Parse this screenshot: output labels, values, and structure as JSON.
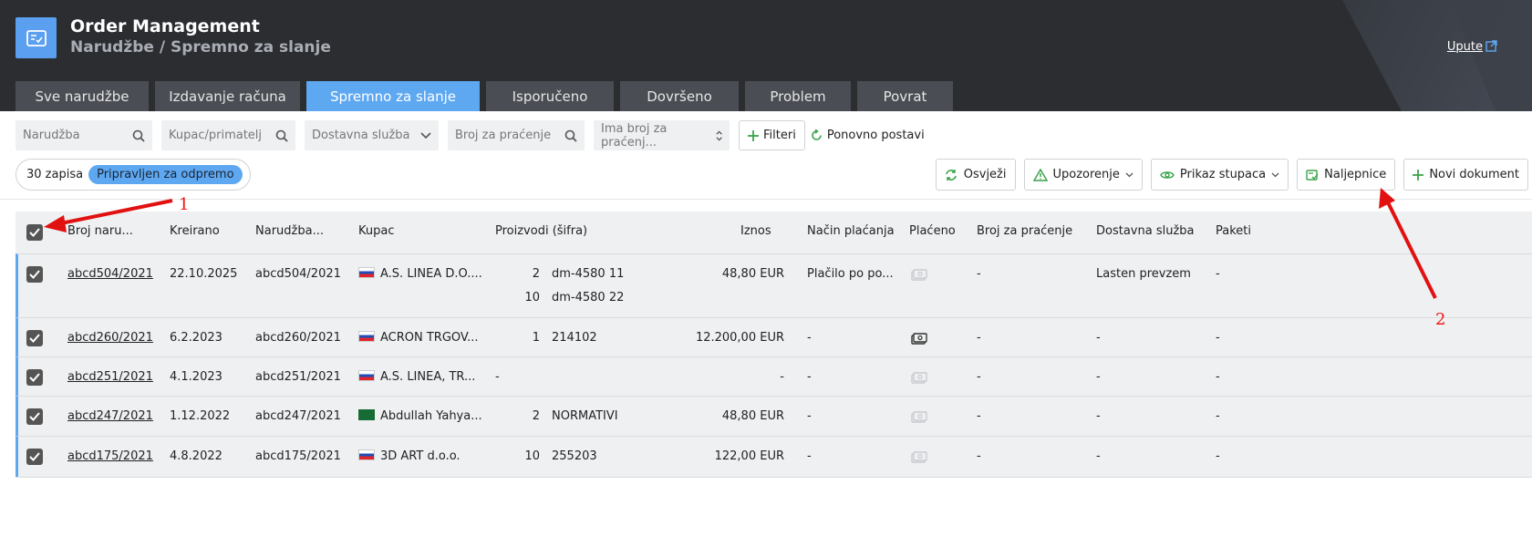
{
  "header": {
    "title": "Order Management",
    "breadcrumb": "Narudžbe / Spremno za slanje",
    "help_link": "Upute"
  },
  "tabs": [
    {
      "label": "Sve narudžbe",
      "active": false
    },
    {
      "label": "Izdavanje računa",
      "active": false
    },
    {
      "label": "Spremno za slanje",
      "active": true
    },
    {
      "label": "Isporučeno",
      "active": false
    },
    {
      "label": "Dovršeno",
      "active": false
    },
    {
      "label": "Problem",
      "active": false
    },
    {
      "label": "Povrat",
      "active": false
    }
  ],
  "filters": {
    "order_placeholder": "Narudžba",
    "customer_placeholder": "Kupac/primatelj",
    "delivery_select": "Dostavna služba",
    "tracking_placeholder": "Broj za praćenje",
    "has_tracking_select": "Ima broj za praćenj...",
    "filters_button": "Filteri",
    "reset_button": "Ponovno postavi"
  },
  "records": {
    "count_text": "30 zapisa",
    "status_pill": "Pripravljen za odpremo"
  },
  "actions": {
    "refresh": "Osvježi",
    "warning": "Upozorenje",
    "columns": "Prikaz stupaca",
    "labels": "Naljepnice",
    "new_document": "Novi dokument"
  },
  "columns": {
    "order_no": "Broj naru...",
    "created": "Kreirano",
    "order": "Narudžba...",
    "customer": "Kupac",
    "products": "Proizvodi (šifra)",
    "amount": "Iznos",
    "payment_method": "Način plaćanja",
    "paid": "Plaćeno",
    "tracking": "Broj za praćenje",
    "delivery": "Dostavna služba",
    "packages": "Paketi"
  },
  "rows": [
    {
      "order_no": "abcd504/2021",
      "created": "22.10.2025",
      "order": "abcd504/2021",
      "flag": "SI",
      "customer": "A.S. LINEA D.O....",
      "products": [
        {
          "qty": "2",
          "code": "dm-4580 11"
        },
        {
          "qty": "10",
          "code": "dm-4580 22"
        }
      ],
      "amount": "48,80 EUR",
      "payment": "Plačilo po po...",
      "paid": false,
      "tracking": "-",
      "delivery": "Lasten prevzem",
      "packages": "-"
    },
    {
      "order_no": "abcd260/2021",
      "created": "6.2.2023",
      "order": "abcd260/2021",
      "flag": "SI",
      "customer": "ACRON TRGOV...",
      "products": [
        {
          "qty": "1",
          "code": "214102"
        }
      ],
      "amount": "12.200,00 EUR",
      "payment": "-",
      "paid": true,
      "tracking": "-",
      "delivery": "-",
      "packages": "-"
    },
    {
      "order_no": "abcd251/2021",
      "created": "4.1.2023",
      "order": "abcd251/2021",
      "flag": "SI",
      "customer": "A.S. LINEA, TR...",
      "products": [
        {
          "qty": "-",
          "code": ""
        }
      ],
      "amount": "-",
      "payment": "-",
      "paid": false,
      "tracking": "-",
      "delivery": "-",
      "packages": "-"
    },
    {
      "order_no": "abcd247/2021",
      "created": "1.12.2022",
      "order": "abcd247/2021",
      "flag": "SA",
      "customer": "Abdullah Yahya...",
      "products": [
        {
          "qty": "2",
          "code": "NORMATIVI"
        }
      ],
      "amount": "48,80 EUR",
      "payment": "-",
      "paid": false,
      "tracking": "-",
      "delivery": "-",
      "packages": "-"
    },
    {
      "order_no": "abcd175/2021",
      "created": "4.8.2022",
      "order": "abcd175/2021",
      "flag": "SI",
      "customer": "3D ART d.o.o.",
      "products": [
        {
          "qty": "10",
          "code": "255203"
        }
      ],
      "amount": "122,00 EUR",
      "payment": "-",
      "paid": false,
      "tracking": "-",
      "delivery": "-",
      "packages": "-"
    }
  ],
  "annotations": {
    "one": "1",
    "two": "2"
  },
  "colors": {
    "accent": "#5ea8f2",
    "header_bg": "#2b2d31",
    "annotation": "#e11111"
  }
}
